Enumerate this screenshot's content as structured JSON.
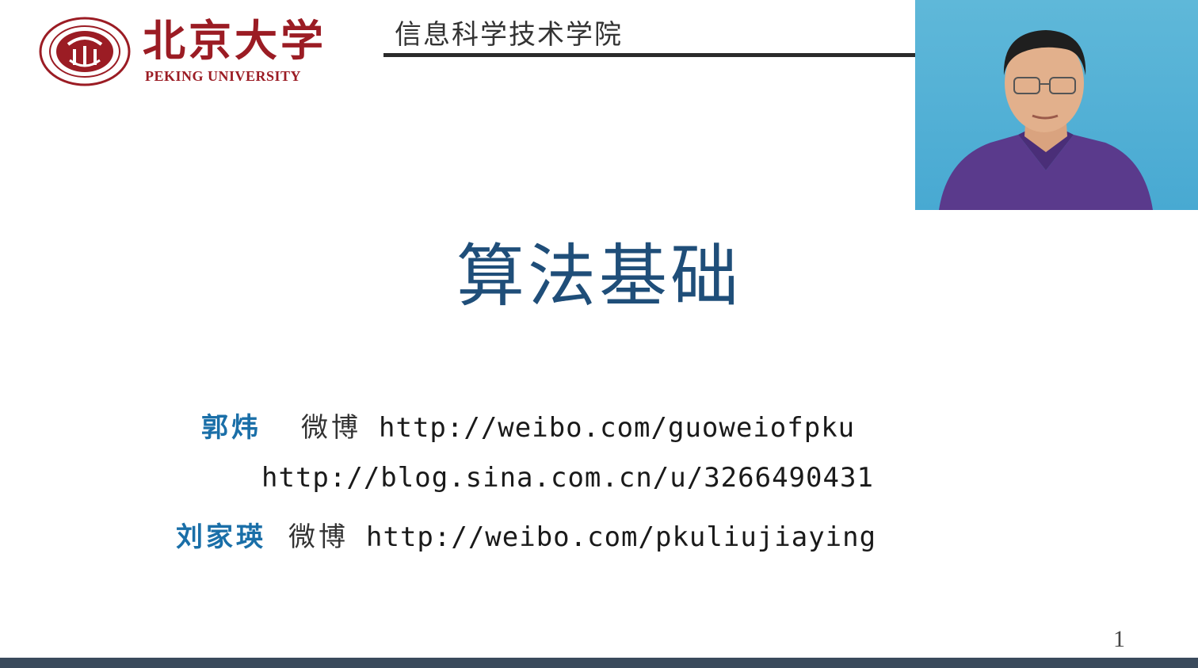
{
  "header": {
    "university_cn": "北京大学",
    "university_en": "PEKING UNIVERSITY",
    "school": "信息科学技术学院",
    "brand_color": "#9b1c24"
  },
  "slide": {
    "title": "算法基础",
    "page_number": "1"
  },
  "authors": [
    {
      "name": "郭炜",
      "weibo_label": "微博",
      "weibo_url": "http://weibo.com/guoweiofpku",
      "blog_url": "http://blog.sina.com.cn/u/3266490431"
    },
    {
      "name": "刘家瑛",
      "weibo_label": "微博",
      "weibo_url": "http://weibo.com/pkuliujiaying"
    }
  ],
  "colors": {
    "title": "#1f4e79",
    "author_name": "#1a6fa8",
    "footer_bar": "#3a4a5c",
    "webcam_bg": "#4fb0d5"
  },
  "icons": {
    "logo": "peking-university-seal-icon"
  }
}
